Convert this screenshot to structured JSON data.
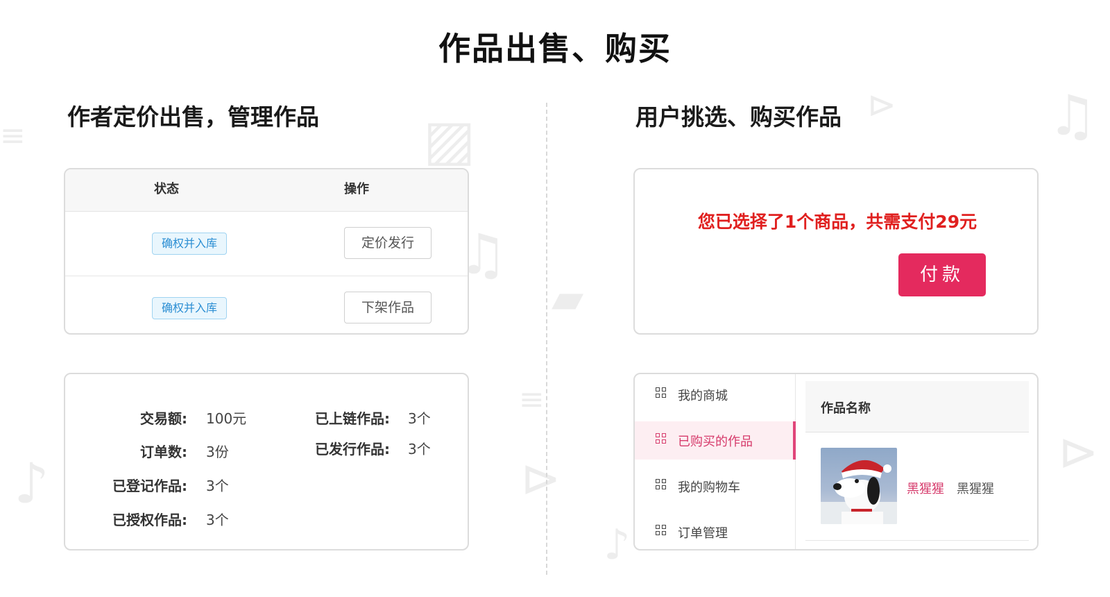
{
  "page_title": "作品出售、购买",
  "left_section": {
    "title": "作者定价出售，管理作品",
    "table": {
      "headers": [
        "状态",
        "操作"
      ],
      "rows": [
        {
          "status": "确权并入库",
          "action": "定价发行"
        },
        {
          "status": "确权并入库",
          "action": "下架作品"
        }
      ]
    },
    "stats": {
      "trade_amount_label": "交易额:",
      "trade_amount_value": "100元",
      "order_count_label": "订单数:",
      "order_count_value": "3份",
      "registered_label": "已登记作品:",
      "registered_value": "3个",
      "authorized_label": "已授权作品:",
      "authorized_value": "3个",
      "onchain_label": "已上链作品:",
      "onchain_value": "3个",
      "published_label": "已发行作品:",
      "published_value": "3个"
    }
  },
  "right_section": {
    "title": "用户挑选、购买作品",
    "payment": {
      "message": "您已选择了1个商品，共需支付29元",
      "pay_button": "付款"
    },
    "menu": [
      {
        "label": "我的商城",
        "active": false
      },
      {
        "label": "已购买的作品",
        "active": true
      },
      {
        "label": "我的购物车",
        "active": false
      },
      {
        "label": "订单管理",
        "active": false
      }
    ],
    "works": {
      "column_header": "作品名称",
      "items": [
        {
          "name": "黑猩猩",
          "author": "黑猩猩",
          "image": "snoopy-santa-thumbnail"
        }
      ]
    }
  },
  "colors": {
    "accent_pink": "#e42a5e",
    "alert_red": "#e0201f",
    "tag_blue": "#2b8ed3"
  }
}
